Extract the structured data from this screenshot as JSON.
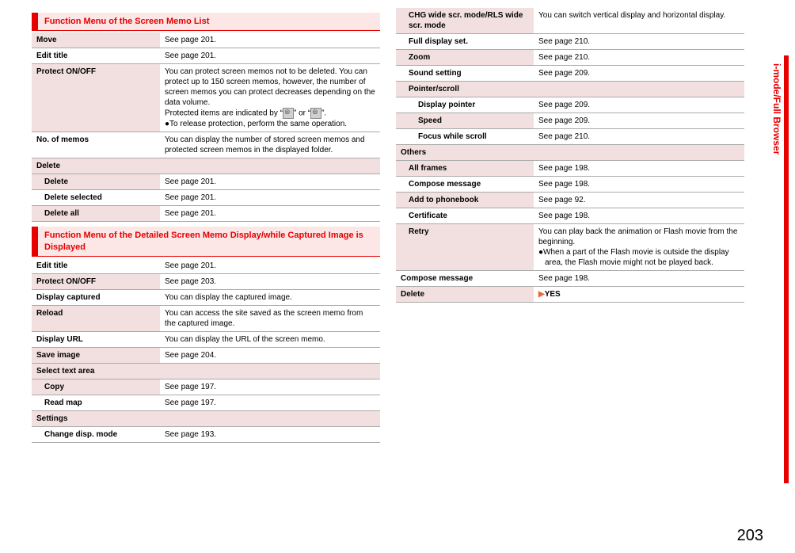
{
  "sideTab": "i-mode/Full Browser",
  "pageNumber": "203",
  "leftColumn": {
    "header1": "Function Menu of the Screen Memo List",
    "tbl1": {
      "move": {
        "label": "Move",
        "desc": "See page 201."
      },
      "editTitle": {
        "label": "Edit title",
        "desc": "See page 201."
      },
      "protect": {
        "label": "Protect ON/OFF",
        "desc1": "You can protect screen memos not to be deleted. You can protect up to 150 screen memos, however, the number of screen memos you can protect decreases depending on the data volume.",
        "desc2a": "Protected items are indicated by “",
        "desc2b": "” or “",
        "desc2c": "”.",
        "desc3": "●To release protection, perform the same operation."
      },
      "noOfMemos": {
        "label": "No. of memos",
        "desc": "You can display the number of stored screen memos and protected screen memos in the displayed folder."
      },
      "deleteGroup": "Delete",
      "delete": {
        "label": "Delete",
        "desc": "See page 201."
      },
      "deleteSelected": {
        "label": "Delete selected",
        "desc": "See page 201."
      },
      "deleteAll": {
        "label": "Delete all",
        "desc": "See page 201."
      }
    },
    "header2": "Function Menu of the Detailed Screen Memo Display/while Captured Image is Displayed",
    "tbl2": {
      "editTitle": {
        "label": "Edit title",
        "desc": "See page 201."
      },
      "protect": {
        "label": "Protect ON/OFF",
        "desc": "See page 203."
      },
      "displayCaptured": {
        "label": "Display captured",
        "desc": "You can display the captured image."
      },
      "reload": {
        "label": "Reload",
        "desc": "You can access the site saved as the screen memo from the captured image."
      },
      "displayURL": {
        "label": "Display URL",
        "desc": "You can display the URL of the screen memo."
      },
      "saveImage": {
        "label": "Save image",
        "desc": "See page 204."
      },
      "selectTextGroup": "Select text area",
      "copy": {
        "label": "Copy",
        "desc": "See page 197."
      },
      "readMap": {
        "label": "Read map",
        "desc": "See page 197."
      },
      "settingsGroup": "Settings",
      "changeDisp": {
        "label": "Change disp. mode",
        "desc": "See page 193."
      }
    }
  },
  "rightColumn": {
    "tbl3": {
      "chgWide": {
        "label": "CHG wide scr. mode/RLS wide scr. mode",
        "desc": "You can switch vertical display and horizontal display."
      },
      "fullDisplay": {
        "label": "Full display set.",
        "desc": "See page 210."
      },
      "zoom": {
        "label": "Zoom",
        "desc": "See page 210."
      },
      "soundSetting": {
        "label": "Sound setting",
        "desc": "See page 209."
      },
      "pointerGroup": "Pointer/scroll",
      "displayPointer": {
        "label": "Display pointer",
        "desc": "See page 209."
      },
      "speed": {
        "label": "Speed",
        "desc": "See page 209."
      },
      "focusWhile": {
        "label": "Focus while scroll",
        "desc": "See page 210."
      },
      "othersGroup": "Others",
      "allFrames": {
        "label": "All frames",
        "desc": "See page 198."
      },
      "composeMsg1": {
        "label": "Compose message",
        "desc": "See page 198."
      },
      "addPhonebook": {
        "label": "Add to phonebook",
        "desc": "See page 92."
      },
      "certificate": {
        "label": "Certificate",
        "desc": "See page 198."
      },
      "retry": {
        "label": "Retry",
        "desc1": "You can play back the animation or Flash movie from the beginning.",
        "desc2": "●When a part of the Flash movie is outside the display area, the Flash movie might not be played back."
      },
      "composeMsg2": {
        "label": "Compose message",
        "desc": "See page 198."
      },
      "delete": {
        "label": "Delete",
        "arrow": "▶",
        "yes": "YES"
      }
    }
  }
}
